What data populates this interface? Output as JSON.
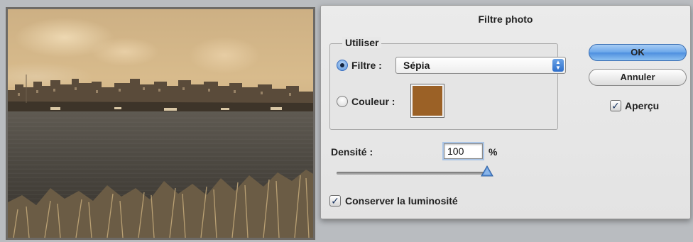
{
  "dialog": {
    "title": "Filtre photo",
    "group_label": "Utiliser",
    "filter_label": "Filtre :",
    "filter_value": "Sépia",
    "color_label": "Couleur :",
    "color_swatch": "#9b6126",
    "ok_label": "OK",
    "cancel_label": "Annuler",
    "preview_label": "Aperçu",
    "preview_checked": true,
    "density_label": "Densité :",
    "density_value": "100",
    "density_unit": "%",
    "density_slider_level": 1.0,
    "preserve_label": "Conserver la luminosité",
    "preserve_checked": true,
    "selected_mode": "filter"
  },
  "icons": {
    "checkmark": "check-icon",
    "select_arrows": "updown-arrows-icon"
  },
  "colors": {
    "accent": "#4c8edf",
    "sepia": "#9b6126"
  }
}
